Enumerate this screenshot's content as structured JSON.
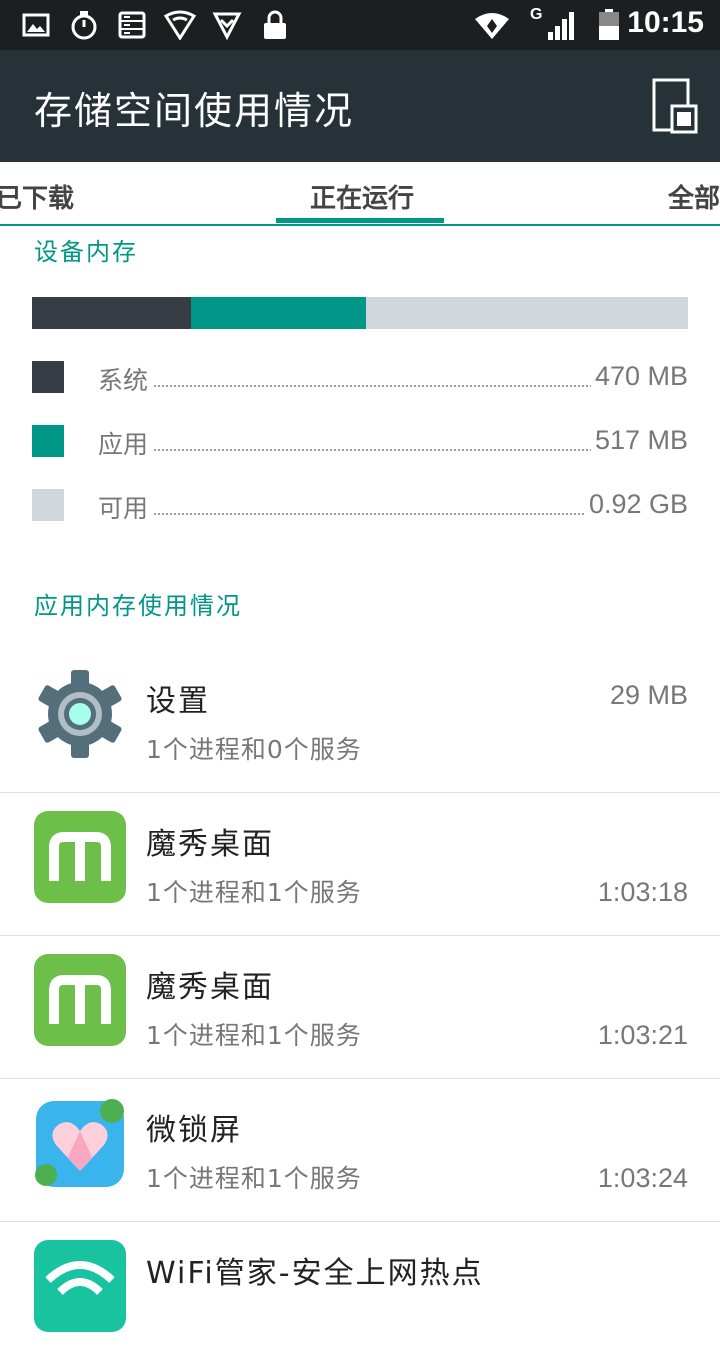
{
  "status_bar": {
    "time": "10:15",
    "network_label": "G"
  },
  "header": {
    "title": "存储空间使用情况"
  },
  "tabs": [
    {
      "label": "已下载"
    },
    {
      "label": "正在运行"
    },
    {
      "label": "全部"
    }
  ],
  "device_memory": {
    "heading": "设备内存",
    "usage": [
      {
        "label": "系统",
        "value": "470 MB",
        "fraction": 0.242,
        "color": "#373c45"
      },
      {
        "label": "应用",
        "value": "517 MB",
        "fraction": 0.267,
        "color": "#009688"
      },
      {
        "label": "可用",
        "value": "0.92 GB",
        "fraction": 0.491,
        "color": "#cfd6dc"
      }
    ]
  },
  "app_memory": {
    "heading": "应用内存使用情况",
    "apps": [
      {
        "name": "设置",
        "subtitle": "1个进程和0个服务",
        "value": "29 MB",
        "icon": "settings-gear-icon"
      },
      {
        "name": "魔秀桌面",
        "subtitle": "1个进程和1个服务",
        "value": "1:03:18",
        "icon": "moxiu-launcher-icon"
      },
      {
        "name": "魔秀桌面",
        "subtitle": "1个进程和1个服务",
        "value": "1:03:21",
        "icon": "moxiu-launcher-icon"
      },
      {
        "name": "微锁屏",
        "subtitle": "1个进程和1个服务",
        "value": "1:03:24",
        "icon": "heart-lockscreen-icon"
      },
      {
        "name": "WiFi管家-安全上网热点",
        "subtitle": "",
        "value": "",
        "icon": "wifi-manager-icon"
      }
    ]
  },
  "colors": {
    "accent": "#009688",
    "action_bar": "#263238",
    "status_bar": "#1b1f22"
  }
}
